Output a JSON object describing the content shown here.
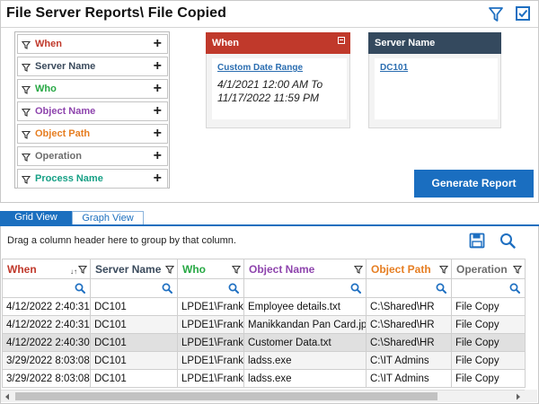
{
  "header": {
    "title": "File Server Reports\\ File Copied"
  },
  "filters": [
    {
      "label": "When",
      "color": "#c0392b"
    },
    {
      "label": "Server Name",
      "color": "#3a4a5c"
    },
    {
      "label": "Who",
      "color": "#27a844"
    },
    {
      "label": "Object Name",
      "color": "#8e44ad"
    },
    {
      "label": "Object Path",
      "color": "#e67e22"
    },
    {
      "label": "Operation",
      "color": "#6d6d6d"
    },
    {
      "label": "Process Name",
      "color": "#16a085"
    }
  ],
  "filter_plus": "+",
  "cards": {
    "when": {
      "title": "When",
      "color": "#c0392b",
      "link": "Custom Date Range",
      "line1": "4/1/2021 12:00 AM To",
      "line2": "11/17/2022 11:59 PM"
    },
    "server": {
      "title": "Server Name",
      "color": "#34495e",
      "link": "DC101"
    }
  },
  "generate_label": "Generate Report",
  "tabs": {
    "grid": "Grid View",
    "graph": "Graph View"
  },
  "group_hint": "Drag a column header here to group by that column.",
  "columns": [
    {
      "label": "When",
      "color": "#c0392b",
      "sort": "↓↑"
    },
    {
      "label": "Server Name",
      "color": "#3a4a5c"
    },
    {
      "label": "Who",
      "color": "#27a844"
    },
    {
      "label": "Object Name",
      "color": "#8e44ad"
    },
    {
      "label": "Object Path",
      "color": "#e67e22"
    },
    {
      "label": "Operation",
      "color": "#6d6d6d"
    }
  ],
  "rows": [
    [
      "4/12/2022 2:40:31",
      "DC101",
      "LPDE1\\Frank",
      "Employee details.txt",
      "C:\\Shared\\HR",
      "File Copy"
    ],
    [
      "4/12/2022 2:40:31",
      "DC101",
      "LPDE1\\Frank",
      "Manikkandan Pan Card.jpg",
      "C:\\Shared\\HR",
      "File Copy"
    ],
    [
      "4/12/2022 2:40:30",
      "DC101",
      "LPDE1\\Frank",
      "Customer Data.txt",
      "C:\\Shared\\HR",
      "File Copy"
    ],
    [
      "3/29/2022 8:03:08",
      "DC101",
      "LPDE1\\Frank",
      "ladss.exe",
      "C:\\IT Admins",
      "File Copy"
    ],
    [
      "3/29/2022 8:03:08",
      "DC101",
      "LPDE1\\Frank",
      "ladss.exe",
      "C:\\IT Admins",
      "File Copy"
    ]
  ],
  "icons": {
    "funnel": "funnel-icon",
    "checkbox": "checkbox-icon",
    "save": "floppy-disk-icon",
    "search": "magnifier-icon"
  },
  "accent": "#1b6fbf"
}
